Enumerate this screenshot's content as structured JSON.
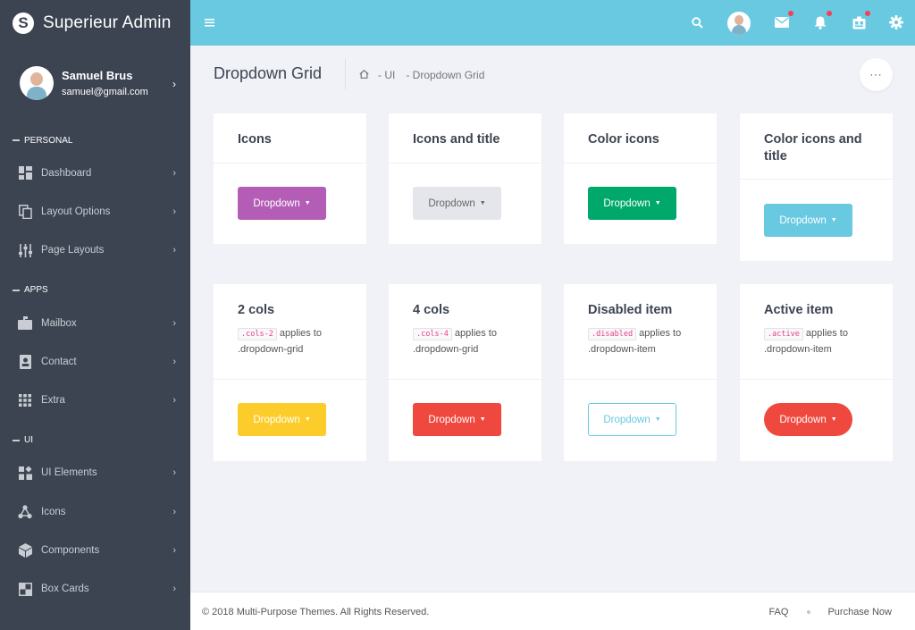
{
  "brand": {
    "logo_letter": "S",
    "name": "Superieur Admin"
  },
  "user": {
    "name": "Samuel Brus",
    "email": "samuel@gmail.com"
  },
  "sidebar": {
    "sections": [
      {
        "label": "PERSONAL",
        "items": [
          {
            "label": "Dashboard",
            "icon": "dashboard-icon"
          },
          {
            "label": "Layout Options",
            "icon": "copy-icon"
          },
          {
            "label": "Page Layouts",
            "icon": "sliders-icon"
          }
        ]
      },
      {
        "label": "APPS",
        "items": [
          {
            "label": "Mailbox",
            "icon": "mailbox-icon"
          },
          {
            "label": "Contact",
            "icon": "contact-icon"
          },
          {
            "label": "Extra",
            "icon": "grid-icon"
          }
        ]
      },
      {
        "label": "UI",
        "items": [
          {
            "label": "UI Elements",
            "icon": "widgets-icon"
          },
          {
            "label": "Icons",
            "icon": "molecule-icon"
          },
          {
            "label": "Components",
            "icon": "cube-icon"
          },
          {
            "label": "Box Cards",
            "icon": "cards-icon"
          }
        ]
      }
    ]
  },
  "header": {
    "title": "Dropdown Grid",
    "breadcrumb": [
      "- UI",
      "- Dropdown Grid"
    ],
    "more_label": "···"
  },
  "cards": [
    {
      "title": "Icons",
      "button": "Dropdown",
      "color": "#b45db6"
    },
    {
      "title": "Icons and title",
      "button": "Dropdown",
      "color": "#e4e6eb"
    },
    {
      "title": "Color icons",
      "button": "Dropdown",
      "color": "#00a86b"
    },
    {
      "title": "Color icons and title",
      "button": "Dropdown",
      "color": "#69c9e1"
    },
    {
      "title": "2 cols",
      "code": ".cols-2",
      "desc_a": "applies to",
      "desc_b": ".dropdown-grid",
      "button": "Dropdown",
      "color": "#fccd2a"
    },
    {
      "title": "4 cols",
      "code": ".cols-4",
      "desc_a": "applies to",
      "desc_b": ".dropdown-grid",
      "button": "Dropdown",
      "color": "#ef483e"
    },
    {
      "title": "Disabled item",
      "code": ".disabled",
      "desc_a": "applies to",
      "desc_b": ".dropdown-item",
      "button": "Dropdown",
      "color": "#69c9e1"
    },
    {
      "title": "Active item",
      "code": ".active",
      "desc_a": "applies to",
      "desc_b": ".dropdown-item",
      "button": "Dropdown",
      "color": "#ef483e"
    }
  ],
  "footer": {
    "copyright": "© 2018 Multi-Purpose Themes. All Rights Reserved.",
    "faq": "FAQ",
    "purchase": "Purchase Now"
  }
}
